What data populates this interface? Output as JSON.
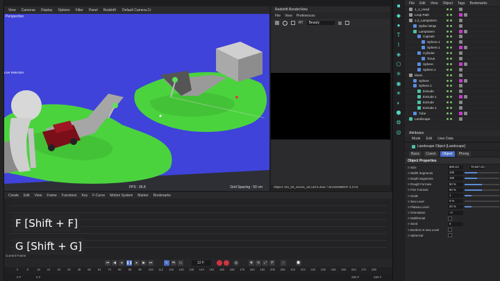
{
  "viewport": {
    "menu": [
      "View",
      "Cameras",
      "Display",
      "Options",
      "Filter",
      "Panel",
      "Redshift"
    ],
    "camera": "Default Camera.Cr",
    "label": "Perspective",
    "selection": "Live Selection",
    "fps": "FPS : 36.8",
    "grid": "Grid Spacing : 50 cm"
  },
  "render_view": {
    "title": "Redshift RenderView",
    "menu": [
      "File",
      "View",
      "Preferences"
    ],
    "tool_labels": [
      "RT"
    ],
    "dropdown": "Beauty",
    "status": "Object: DH_03_Scene_34.c4d 6.4sec / SHADDMENT 4.3 Hz"
  },
  "object_manager": {
    "tabs": [
      "File",
      "Edit",
      "View",
      "Object",
      "Tags",
      "Bookmarks"
    ],
    "objects": [
      {
        "name": "1_1_Head",
        "indent": 0,
        "icon": "gray"
      },
      {
        "name": "Loop Path",
        "indent": 0,
        "icon": "gray"
      },
      {
        "name": "1.2_Lamptotem",
        "indent": 0,
        "icon": "gray"
      },
      {
        "name": "Spline Wrap",
        "indent": 1,
        "icon": "blue"
      },
      {
        "name": "Lamptotem",
        "indent": 1,
        "icon": "green"
      },
      {
        "name": "Capsule",
        "indent": 2,
        "icon": "blue"
      },
      {
        "name": "Sphere.1",
        "indent": 3,
        "icon": "blue"
      },
      {
        "name": "Sphere.1",
        "indent": 3,
        "icon": "blue"
      },
      {
        "name": "Cylinder",
        "indent": 2,
        "icon": "blue"
      },
      {
        "name": "Torus",
        "indent": 3,
        "icon": "blue"
      },
      {
        "name": "Sphere",
        "indent": 2,
        "icon": "blue"
      },
      {
        "name": "Sphere.1",
        "indent": 2,
        "icon": "blue"
      },
      {
        "name": "Moon",
        "indent": 0,
        "icon": "gray"
      },
      {
        "name": "Sphere",
        "indent": 1,
        "icon": "blue"
      },
      {
        "name": "Sphere.1",
        "indent": 1,
        "icon": "blue"
      },
      {
        "name": "Extrude",
        "indent": 2,
        "icon": "green"
      },
      {
        "name": "Extrude.1",
        "indent": 2,
        "icon": "green"
      },
      {
        "name": "Extrude",
        "indent": 2,
        "icon": "green"
      },
      {
        "name": "Extrude.1",
        "indent": 2,
        "icon": "green"
      },
      {
        "name": "Tube",
        "indent": 1,
        "icon": "blue"
      },
      {
        "name": "Landscape",
        "indent": 0,
        "icon": "green"
      }
    ]
  },
  "attributes": {
    "title": "Attributes",
    "menu": [
      "Mode",
      "Edit",
      "User Data"
    ],
    "object": "Landscape Object [Landscape]",
    "tabs": [
      "Basic",
      "Coord.",
      "Object",
      "Phong"
    ],
    "active_tab": "Object",
    "section": "Object Properties",
    "props": [
      {
        "label": "Size",
        "v1": "800 cm",
        "v2": "70.047 cm",
        "slider": -1
      },
      {
        "label": "Width Segments",
        "v1": "100",
        "v2": "",
        "slider": 0.35
      },
      {
        "label": "Depth Segments",
        "v1": "100",
        "v2": "",
        "slider": 0.35
      },
      {
        "label": "Rough Furrows",
        "v1": "50 %",
        "v2": "",
        "slider": 0.5
      },
      {
        "label": "Fine Furrows",
        "v1": "50 %",
        "v2": "",
        "slider": 0.5
      },
      {
        "label": "Scale",
        "v1": "1",
        "v2": "",
        "slider": 0.2
      },
      {
        "label": "Sea Level",
        "v1": "0 %",
        "v2": "",
        "slider": 0
      },
      {
        "label": "Plateau Level",
        "v1": "20 %",
        "v2": "",
        "slider": 0.2
      },
      {
        "label": "Orientation",
        "v1": "+Y",
        "v2": "",
        "slider": -1
      },
      {
        "label": "Multifractal",
        "v1": "",
        "v2": "",
        "slider": -2
      },
      {
        "label": "Seed",
        "v1": "0",
        "v2": "",
        "slider": -1
      },
      {
        "label": "Borders At Sea Level",
        "v1": "",
        "v2": "",
        "slider": -2
      },
      {
        "label": "Spherical",
        "v1": "",
        "v2": "",
        "slider": -2
      }
    ]
  },
  "timeline": {
    "menu": [
      "Create",
      "Edit",
      "View",
      "Frame",
      "Functions",
      "Key",
      "F-Curve",
      "Motion System",
      "Marker",
      "Bookmarks"
    ],
    "hint1": "F [Shift + F]",
    "hint2": "G [Shift + G]",
    "current": "Current Frame",
    "frame": "12 F",
    "ticks": [
      "0",
      "8",
      "16",
      "24",
      "32",
      "40",
      "48",
      "56",
      "64",
      "72",
      "80",
      "88",
      "96",
      "104",
      "112",
      "120",
      "128",
      "136",
      "144",
      "152",
      "160",
      "168",
      "176",
      "184",
      "192",
      "200",
      "208",
      "216",
      "224",
      "232",
      "240",
      "248",
      "256",
      "264",
      "272",
      "280"
    ],
    "start": "0 F",
    "preview": "0 F",
    "end": "280 F",
    "end2": "280 F"
  },
  "colors": {
    "accent": "#4a6cc7",
    "teal": "#4cc2a9",
    "magenta": "#c83ad0",
    "sky": "#3f43d9",
    "grass": "#4bd33e"
  }
}
